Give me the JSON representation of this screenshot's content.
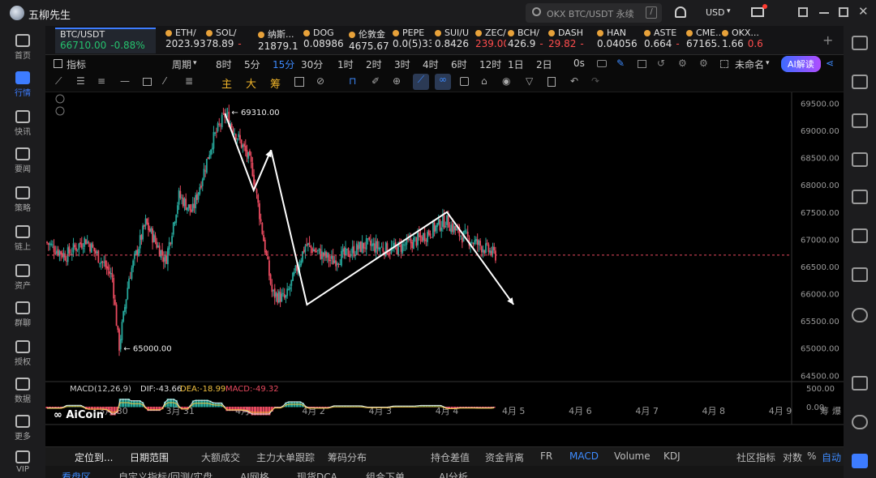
{
  "app": {
    "title": "五柳先生",
    "search_placeholder": "OKX BTC/USDT 永续",
    "search_key": "/",
    "currency": "USD"
  },
  "leftnav": [
    {
      "label": "首页",
      "icon": "home-icon"
    },
    {
      "label": "行情",
      "icon": "chart-bars-icon",
      "active": true
    },
    {
      "label": "快讯",
      "icon": "news-icon"
    },
    {
      "label": "要闻",
      "icon": "document-icon"
    },
    {
      "label": "策略",
      "icon": "robot-icon"
    },
    {
      "label": "链上",
      "icon": "chain-icon"
    },
    {
      "label": "资产",
      "icon": "wallet-icon"
    },
    {
      "label": "群聊",
      "icon": "chat-icon"
    },
    {
      "label": "授权",
      "icon": "key-icon"
    },
    {
      "label": "数据",
      "icon": "data-icon"
    },
    {
      "label": "更多",
      "icon": "grid-icon"
    },
    {
      "label": "VIP",
      "icon": "crown-icon"
    }
  ],
  "tickers": [
    {
      "name": "BTC/USDT",
      "price": "66710.00",
      "change": "-0.88%",
      "active": true
    },
    {
      "name": "ETH/",
      "price": "2023.93"
    },
    {
      "name": "SOL/",
      "price": "78.89",
      "change": "-"
    },
    {
      "name": "纳斯...",
      "price": "21879.1"
    },
    {
      "name": "DOG",
      "price": "0.08986"
    },
    {
      "name": "伦敦金",
      "price": "4675.67"
    },
    {
      "name": "PEPE",
      "price": "0.0(5)33"
    },
    {
      "name": "SUI/U",
      "price": "0.8426"
    },
    {
      "name": "ZEC/",
      "price": "239.00",
      "color": "#ff4d4d"
    },
    {
      "name": "BCH/",
      "price": "426.9",
      "change": "-"
    },
    {
      "name": "DASH",
      "price": "29.82",
      "change": "-",
      "color": "#ff4d4d"
    },
    {
      "name": "HAN",
      "price": "0.04056"
    },
    {
      "name": "ASTE",
      "price": "0.664",
      "change": "-"
    },
    {
      "name": "CME...",
      "price": "67165.0"
    },
    {
      "name": "OKX...",
      "price": "1.66",
      "change": "0.6"
    }
  ],
  "toolbar": {
    "indicators": "指标",
    "period": "周期",
    "intervals": [
      "8时",
      "5分",
      "15分",
      "30分",
      "1时",
      "2时",
      "3时",
      "4时",
      "6时",
      "12时",
      "1日",
      "2日"
    ],
    "selected_interval": "15分",
    "zero": "0s",
    "unnamed": "未命名",
    "ai": "AI解读"
  },
  "drawtools": {
    "main": "主",
    "big": "大",
    "chips": "筹"
  },
  "chart_data": {
    "type": "candlestick",
    "symbol": "BTC/USDT",
    "y_ticks": [
      "69500.00",
      "69000.00",
      "68500.00",
      "68000.00",
      "67500.00",
      "67000.00",
      "66500.00",
      "66000.00",
      "65500.00",
      "65000.00",
      "64500.00"
    ],
    "ylim": [
      64400,
      69700
    ],
    "x_ticks": [
      "3月 30",
      "3月 31",
      "4月 1",
      "4月 2",
      "4月 3",
      "4月 4",
      "4月 5",
      "4月 6",
      "4月 7",
      "4月 8",
      "4月 9"
    ],
    "high_label": "69310.00",
    "low_label": "65000.00",
    "current_price": 66710.0,
    "path": [
      [
        0,
        66950
      ],
      [
        0.3,
        66700
      ],
      [
        0.6,
        67000
      ],
      [
        0.9,
        66500
      ],
      [
        1.0,
        66300
      ],
      [
        1.1,
        65000
      ],
      [
        1.25,
        66300
      ],
      [
        1.5,
        67300
      ],
      [
        1.8,
        66600
      ],
      [
        2.0,
        67800
      ],
      [
        2.2,
        67500
      ],
      [
        2.5,
        68800
      ],
      [
        2.7,
        69310
      ],
      [
        3.0,
        68600
      ],
      [
        3.1,
        68300
      ],
      [
        3.4,
        66000
      ],
      [
        3.6,
        65900
      ],
      [
        3.9,
        66900
      ],
      [
        4.3,
        66600
      ],
      [
        4.8,
        66900
      ],
      [
        5.2,
        66800
      ],
      [
        5.6,
        67000
      ],
      [
        6.0,
        67350
      ],
      [
        6.2,
        67100
      ],
      [
        6.5,
        66900
      ],
      [
        6.75,
        66710
      ]
    ],
    "arrows": [
      [
        [
          2.67,
          69310
        ],
        [
          3.1,
          67900
        ],
        [
          3.36,
          68640
        ]
      ],
      [
        [
          3.36,
          68640
        ],
        [
          3.9,
          65800
        ],
        [
          6.0,
          67500
        ],
        [
          7.0,
          65800
        ]
      ]
    ],
    "macd": {
      "label": "MACD(12,26,9)",
      "dif": "DIF:-43.66",
      "dea": "DEA:-18.99",
      "macd": "MACD:-49.32",
      "y_ticks": [
        "500.00",
        "0.00"
      ]
    }
  },
  "bottom": {
    "locate": "定位到...",
    "date_range": "日期范围",
    "items": [
      "大额成交",
      "主力大单跟踪",
      "筹码分布",
      "持仓差值",
      "资金背离",
      "FR",
      "MACD",
      "Volume",
      "KDJ"
    ],
    "selected": "MACD",
    "community": "社区指标",
    "log": "对数",
    "pct": "%",
    "auto": "自动"
  },
  "tabs": [
    "看盘区",
    "自定义指标/回测/实盘",
    "AI网格",
    "现货DCA",
    "组合下单",
    "AI分析"
  ],
  "watermark": "AiCoin"
}
